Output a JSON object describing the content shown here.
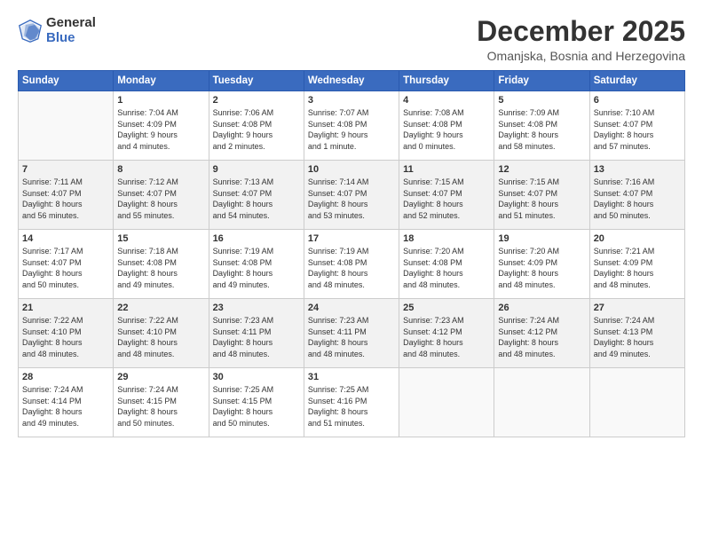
{
  "logo": {
    "general": "General",
    "blue": "Blue"
  },
  "title": "December 2025",
  "subtitle": "Omanjska, Bosnia and Herzegovina",
  "columns": [
    "Sunday",
    "Monday",
    "Tuesday",
    "Wednesday",
    "Thursday",
    "Friday",
    "Saturday"
  ],
  "weeks": [
    [
      {
        "day": "",
        "info": ""
      },
      {
        "day": "1",
        "info": "Sunrise: 7:04 AM\nSunset: 4:09 PM\nDaylight: 9 hours\nand 4 minutes."
      },
      {
        "day": "2",
        "info": "Sunrise: 7:06 AM\nSunset: 4:08 PM\nDaylight: 9 hours\nand 2 minutes."
      },
      {
        "day": "3",
        "info": "Sunrise: 7:07 AM\nSunset: 4:08 PM\nDaylight: 9 hours\nand 1 minute."
      },
      {
        "day": "4",
        "info": "Sunrise: 7:08 AM\nSunset: 4:08 PM\nDaylight: 9 hours\nand 0 minutes."
      },
      {
        "day": "5",
        "info": "Sunrise: 7:09 AM\nSunset: 4:08 PM\nDaylight: 8 hours\nand 58 minutes."
      },
      {
        "day": "6",
        "info": "Sunrise: 7:10 AM\nSunset: 4:07 PM\nDaylight: 8 hours\nand 57 minutes."
      }
    ],
    [
      {
        "day": "7",
        "info": "Sunrise: 7:11 AM\nSunset: 4:07 PM\nDaylight: 8 hours\nand 56 minutes."
      },
      {
        "day": "8",
        "info": "Sunrise: 7:12 AM\nSunset: 4:07 PM\nDaylight: 8 hours\nand 55 minutes."
      },
      {
        "day": "9",
        "info": "Sunrise: 7:13 AM\nSunset: 4:07 PM\nDaylight: 8 hours\nand 54 minutes."
      },
      {
        "day": "10",
        "info": "Sunrise: 7:14 AM\nSunset: 4:07 PM\nDaylight: 8 hours\nand 53 minutes."
      },
      {
        "day": "11",
        "info": "Sunrise: 7:15 AM\nSunset: 4:07 PM\nDaylight: 8 hours\nand 52 minutes."
      },
      {
        "day": "12",
        "info": "Sunrise: 7:15 AM\nSunset: 4:07 PM\nDaylight: 8 hours\nand 51 minutes."
      },
      {
        "day": "13",
        "info": "Sunrise: 7:16 AM\nSunset: 4:07 PM\nDaylight: 8 hours\nand 50 minutes."
      }
    ],
    [
      {
        "day": "14",
        "info": "Sunrise: 7:17 AM\nSunset: 4:07 PM\nDaylight: 8 hours\nand 50 minutes."
      },
      {
        "day": "15",
        "info": "Sunrise: 7:18 AM\nSunset: 4:08 PM\nDaylight: 8 hours\nand 49 minutes."
      },
      {
        "day": "16",
        "info": "Sunrise: 7:19 AM\nSunset: 4:08 PM\nDaylight: 8 hours\nand 49 minutes."
      },
      {
        "day": "17",
        "info": "Sunrise: 7:19 AM\nSunset: 4:08 PM\nDaylight: 8 hours\nand 48 minutes."
      },
      {
        "day": "18",
        "info": "Sunrise: 7:20 AM\nSunset: 4:08 PM\nDaylight: 8 hours\nand 48 minutes."
      },
      {
        "day": "19",
        "info": "Sunrise: 7:20 AM\nSunset: 4:09 PM\nDaylight: 8 hours\nand 48 minutes."
      },
      {
        "day": "20",
        "info": "Sunrise: 7:21 AM\nSunset: 4:09 PM\nDaylight: 8 hours\nand 48 minutes."
      }
    ],
    [
      {
        "day": "21",
        "info": "Sunrise: 7:22 AM\nSunset: 4:10 PM\nDaylight: 8 hours\nand 48 minutes."
      },
      {
        "day": "22",
        "info": "Sunrise: 7:22 AM\nSunset: 4:10 PM\nDaylight: 8 hours\nand 48 minutes."
      },
      {
        "day": "23",
        "info": "Sunrise: 7:23 AM\nSunset: 4:11 PM\nDaylight: 8 hours\nand 48 minutes."
      },
      {
        "day": "24",
        "info": "Sunrise: 7:23 AM\nSunset: 4:11 PM\nDaylight: 8 hours\nand 48 minutes."
      },
      {
        "day": "25",
        "info": "Sunrise: 7:23 AM\nSunset: 4:12 PM\nDaylight: 8 hours\nand 48 minutes."
      },
      {
        "day": "26",
        "info": "Sunrise: 7:24 AM\nSunset: 4:12 PM\nDaylight: 8 hours\nand 48 minutes."
      },
      {
        "day": "27",
        "info": "Sunrise: 7:24 AM\nSunset: 4:13 PM\nDaylight: 8 hours\nand 49 minutes."
      }
    ],
    [
      {
        "day": "28",
        "info": "Sunrise: 7:24 AM\nSunset: 4:14 PM\nDaylight: 8 hours\nand 49 minutes."
      },
      {
        "day": "29",
        "info": "Sunrise: 7:24 AM\nSunset: 4:15 PM\nDaylight: 8 hours\nand 50 minutes."
      },
      {
        "day": "30",
        "info": "Sunrise: 7:25 AM\nSunset: 4:15 PM\nDaylight: 8 hours\nand 50 minutes."
      },
      {
        "day": "31",
        "info": "Sunrise: 7:25 AM\nSunset: 4:16 PM\nDaylight: 8 hours\nand 51 minutes."
      },
      {
        "day": "",
        "info": ""
      },
      {
        "day": "",
        "info": ""
      },
      {
        "day": "",
        "info": ""
      }
    ]
  ]
}
